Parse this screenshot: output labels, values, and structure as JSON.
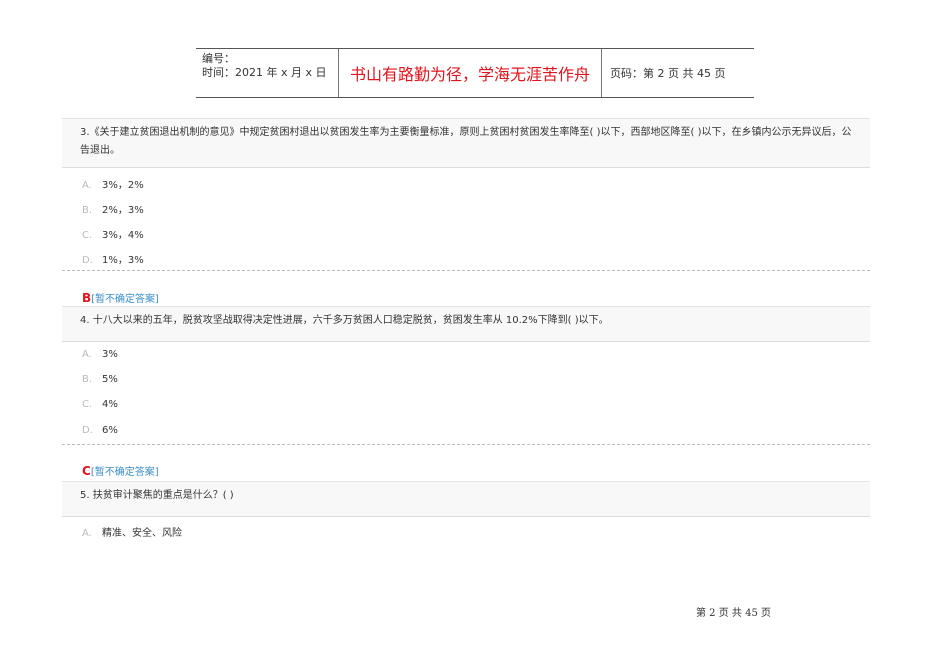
{
  "header": {
    "number_label": "编号：",
    "date_label": "时间：2021 年 x 月 x 日",
    "motto": "书山有路勤为径，学海无涯苦作舟",
    "page_label": "页码：第 2 页  共 45 页"
  },
  "questions": [
    {
      "text": "3.《关于建立贫困退出机制的意见》中规定贫困村退出以贫困发生率为主要衡量标准，原则上贫困村贫困发生率降至( )以下，西部地区降至( )以下，在乡镇内公示无异议后，公告退出。",
      "options": [
        {
          "letter": "A.",
          "text": "3%，2%"
        },
        {
          "letter": "B.",
          "text": "2%，3%"
        },
        {
          "letter": "C.",
          "text": "3%，4%"
        },
        {
          "letter": "D.",
          "text": "1%，3%"
        }
      ],
      "answer": "B",
      "answer_note": "[暂不确定答案]"
    },
    {
      "text": "4. 十八大以来的五年，脱贫攻坚战取得决定性进展，六千多万贫困人口稳定脱贫，贫困发生率从 10.2%下降到( )以下。",
      "options": [
        {
          "letter": "A.",
          "text": "3%"
        },
        {
          "letter": "B.",
          "text": "5%"
        },
        {
          "letter": "C.",
          "text": "4%"
        },
        {
          "letter": "D.",
          "text": "6%"
        }
      ],
      "answer": "C",
      "answer_note": "[暂不确定答案]"
    },
    {
      "text": "5. 扶贫审计聚焦的重点是什么？( )",
      "options": [
        {
          "letter": "A.",
          "text": "精准、安全、风险"
        }
      ]
    }
  ],
  "footer": "第 2 页 共 45 页"
}
